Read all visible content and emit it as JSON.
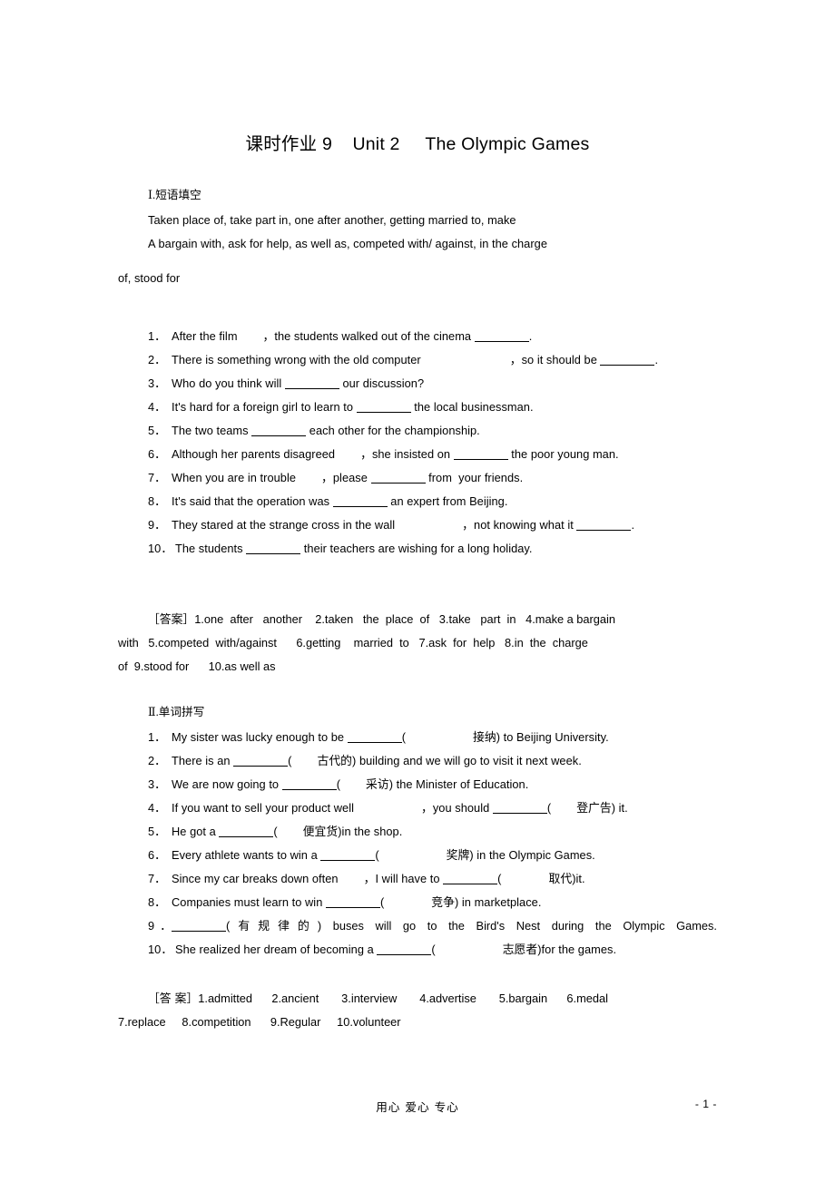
{
  "document": {
    "title": "课时作业 9    Unit 2     The Olympic Games",
    "footer_center": "用心  爱心  专心",
    "footer_page": "- 1 -"
  },
  "section_one": {
    "heading": "Ⅰ.短语填空",
    "word_bank": [
      "Taken place of, take part in, one after another, getting married to, make",
      "A bargain with, ask for help, as well as, competed with/ against, in the charge",
      "of, stood for"
    ],
    "questions": [
      {
        "num": "1．",
        "a": "After the film",
        "b": "，",
        "c": "the students walked out of the cinema ",
        "d": "."
      },
      {
        "num": "2．",
        "a": "There is something wrong with the old computer",
        "b": "，",
        "c": "so it should be ",
        "d": "."
      },
      {
        "num": "3．",
        "a": "Who do you think will ",
        "b": "",
        "c": " our discussion?",
        "d": ""
      },
      {
        "num": "4．",
        "a": "It's hard for a foreign girl to learn to ",
        "b": "",
        "c": " the local businessman.",
        "d": ""
      },
      {
        "num": "5．",
        "a": "The two teams ",
        "b": "",
        "c": " each other for the championship.",
        "d": ""
      },
      {
        "num": "6．",
        "a": "Although her parents disagreed",
        "b": "，",
        "c": "she insisted on ",
        "d": " the poor young man."
      },
      {
        "num": "7．",
        "a": "When you are in trouble",
        "b": "，",
        "c": "please ",
        "d": " from  your friends."
      },
      {
        "num": "8．",
        "a": "It's said that the operation was ",
        "b": "",
        "c": " an expert from Beijing.",
        "d": ""
      },
      {
        "num": "9．",
        "a": "They stared at the strange cross in the wall",
        "b": "，",
        "c": "not knowing what it ",
        "d": "."
      },
      {
        "num": "10．",
        "a": "The students ",
        "b": "",
        "c": " their teachers are wishing for a long holiday.",
        "d": ""
      }
    ],
    "answer_label": "［答案］",
    "answers_line1": "1.one  after   another    2.taken   the  place  of   3.take   part  in   4.make a bargain",
    "answers_line2": "with   5.competed  with/against      6.getting    married  to   7.ask  for  help   8.in  the  charge",
    "answers_line3": "of  9.stood for      10.as well as"
  },
  "section_two": {
    "heading": "Ⅱ.单词拼写",
    "questions": [
      {
        "num": "1．",
        "pre": "My sister was lucky enough to be ",
        "paren_open": "(",
        "cn": "接纳",
        "paren_close": ") to Beijing University."
      },
      {
        "num": "2．",
        "pre": "There is an ",
        "paren_open": "(",
        "cn": "古代的",
        "paren_close": ") building and we will go to visit it next week."
      },
      {
        "num": "3．",
        "pre": "We are now going to ",
        "paren_open": "(",
        "cn": "采访",
        "paren_close": ") the Minister of Education."
      },
      {
        "num": "4．",
        "pre": "If you want to sell your product well",
        "mid": "，you should ",
        "paren_open": "(",
        "cn": "登广告",
        "paren_close": ") it."
      },
      {
        "num": "5．",
        "pre": "He got a ",
        "paren_open": "(",
        "cn": "便宜货",
        "paren_close": ")in the shop."
      },
      {
        "num": "6．",
        "pre": "Every athlete wants to win a ",
        "paren_open": "(",
        "cn": "奖牌",
        "paren_close": ") in the Olympic Games."
      },
      {
        "num": "7．",
        "pre": "Since my car breaks down often",
        "mid": "，I will have to ",
        "paren_open": "(",
        "cn": "取代",
        "paren_close": ")it."
      },
      {
        "num": "8．",
        "pre": "Companies must learn to win ",
        "paren_open": "(",
        "cn": "竞争",
        "paren_close": ") in marketplace."
      },
      {
        "num": "9．",
        "pre": "",
        "paren_open": "(",
        "cn": "有规律的",
        "paren_close": ")",
        "rest": "buses will go to the Bird's Nest during the Olympic Games."
      },
      {
        "num": "10．",
        "pre": "She realized her dream of becoming a ",
        "paren_open": "(",
        "cn": "志愿者",
        "paren_close": ")for the games."
      }
    ],
    "answer_label": "［答 案］",
    "answers_line1": "1.admitted      2.ancient       3.interview       4.advertise       5.bargain      6.medal",
    "answers_line2": "7.replace     8.competition      9.Regular     10.volunteer"
  }
}
